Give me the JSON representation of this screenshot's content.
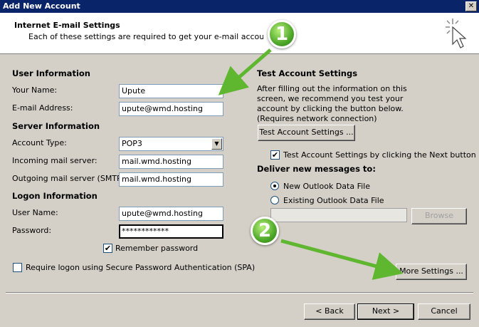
{
  "window": {
    "title": "Add New Account",
    "close_label": "✕"
  },
  "header": {
    "title": "Internet E-mail Settings",
    "subtitle": "Each of these settings are required to get your e-mail account working."
  },
  "user_info": {
    "section": "User Information",
    "name_label": "Your Name:",
    "name_value": "Upute",
    "email_label": "E-mail Address:",
    "email_value": "upute@wmd.hosting"
  },
  "server_info": {
    "section": "Server Information",
    "account_type_label": "Account Type:",
    "account_type_value": "POP3",
    "incoming_label": "Incoming mail server:",
    "incoming_value": "mail.wmd.hosting",
    "outgoing_label": "Outgoing mail server (SMTP):",
    "outgoing_value": "mail.wmd.hosting"
  },
  "logon_info": {
    "section": "Logon Information",
    "username_label": "User Name:",
    "username_value": "upute@wmd.hosting",
    "password_label": "Password:",
    "password_value": "************",
    "remember_label": "Remember password",
    "remember_checked": true,
    "spa_label": "Require logon using Secure Password Authentication (SPA)",
    "spa_checked": false
  },
  "test_settings": {
    "section": "Test Account Settings",
    "description": "After filling out the information on this screen, we recommend you test your account by clicking the button below. (Requires network connection)",
    "test_button": "Test Account Settings ...",
    "test_next_label": "Test Account Settings by clicking the Next button",
    "test_next_checked": true
  },
  "delivery": {
    "section": "Deliver new messages to:",
    "new_file_label": "New Outlook Data File",
    "existing_file_label": "Existing Outlook Data File",
    "selected": "new",
    "browse_button": "Browse",
    "path_value": ""
  },
  "more_settings_button": "More Settings ...",
  "footer": {
    "back_button": "< Back",
    "next_button": "Next >",
    "cancel_button": "Cancel"
  },
  "annotations": {
    "badge1": "1",
    "badge2": "2",
    "accent": "#5fb62f"
  }
}
